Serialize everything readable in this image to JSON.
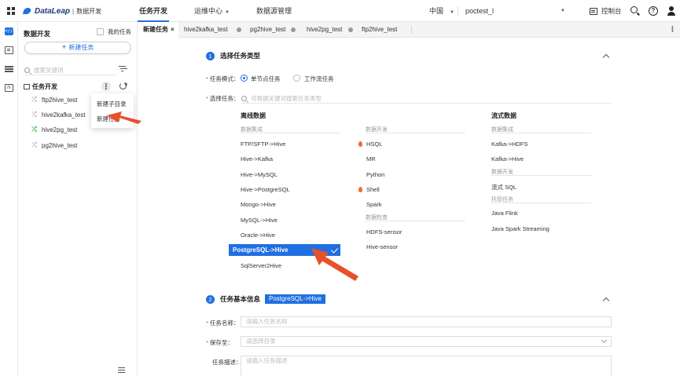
{
  "header": {
    "logo_text": "DataLeap",
    "logo_sep": "|",
    "logo_sub": "数据开发",
    "nav": [
      {
        "label": "任务开发",
        "active": true
      },
      {
        "label": "运维中心",
        "has_caret": true
      },
      {
        "label": "数据源管理"
      }
    ],
    "language": "中国",
    "project": "poctest_l",
    "console": "控制台",
    "help_glyph": "?"
  },
  "rail": {
    "active_glyph": "<//>"
  },
  "sidebar": {
    "title": "数据开发",
    "my_tasks": "我的任务",
    "new_task_button": "新建任务",
    "new_task_plus": "+",
    "search_placeholder": "搜索关键词",
    "tree_root": "任务开发",
    "more_glyph": "⋮",
    "items": [
      {
        "label": "ftp2hive_test",
        "icon": "shuffle-icon"
      },
      {
        "label": "hive2kafka_test",
        "icon": "shuffle-icon"
      },
      {
        "label": "hive2pg_test",
        "icon": "shuffle-icon-green"
      },
      {
        "label": "pg2hive_test",
        "icon": "shuffle-icon"
      }
    ],
    "context_menu": [
      "新建子目录",
      "新建任务"
    ]
  },
  "tabs": [
    {
      "label": "新建任务",
      "active": true,
      "close": "×"
    },
    {
      "label": "hive2kafka_test"
    },
    {
      "label": "pg2hive_test"
    },
    {
      "label": "hive2pg_test"
    },
    {
      "label": "ftp2hive_test"
    }
  ],
  "tab_more": "⋮",
  "section1": {
    "number": "1",
    "title": "选择任务类型",
    "mode_label": "任务模式：",
    "mode_options": [
      "单节点任务",
      "工作流任务"
    ],
    "mode_selected": "单节点任务",
    "select_label": "选择任务：",
    "select_placeholder": "可根据关键词搜索任务类型",
    "columns": {
      "offline": {
        "title": "离线数据",
        "group": "数据集成",
        "items": [
          "FTP/SFTP->Hive",
          "Hive->Kafka",
          "Hive->MySQL",
          "Hive->PostgreSQL",
          "Mongo->Hive",
          "MySQL->Hive",
          "Oracle->Hive",
          "PostgreSQL->Hive",
          "SqlServer2Hive"
        ],
        "selected": "PostgreSQL->Hive"
      },
      "dev": {
        "group": "数据开发",
        "items": [
          "HSQL",
          "MR",
          "Python",
          "Shell",
          "Spark"
        ],
        "hot": [
          "HSQL",
          "Shell"
        ],
        "group2": "数据检查",
        "items2": [
          "HDFS-sensor",
          "Hive-sensor"
        ]
      },
      "stream": {
        "title": "流式数据",
        "group": "数据集成",
        "items": [
          "Kafka->HDFS",
          "Kafka->Hive"
        ],
        "group2": "数据开发",
        "items2": [
          "流式 SQL"
        ],
        "group3": "托管任务",
        "items3": [
          "Java Flink",
          "Java Spark Streaming"
        ]
      }
    }
  },
  "section2": {
    "number": "2",
    "title": "任务基本信息",
    "badge": "PostgreSQL->Hive",
    "name_label": "任务名称：",
    "name_placeholder": "请输入任务名称",
    "save_label": "保存至：",
    "save_placeholder": "请选择目录",
    "desc_label": "任务描述：",
    "desc_placeholder": "请输入任务描述"
  },
  "colors": {
    "accent": "#1f6fe0",
    "arrow": "#e8502a",
    "hot": "#f06a2a",
    "green": "#2fb344"
  }
}
